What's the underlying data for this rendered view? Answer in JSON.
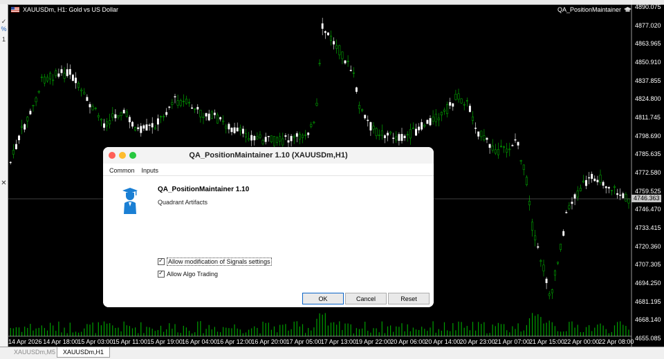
{
  "chart": {
    "symbol_title": "XAUUSDm, H1:  Gold vs US Dollar",
    "ea_badge": "QA_PositionMaintainer",
    "current_price": "4746.363",
    "price_ticks": [
      "4890.075",
      "4877.020",
      "4863.965",
      "4850.910",
      "4837.855",
      "4824.800",
      "4811.745",
      "4798.690",
      "4785.635",
      "4772.580",
      "4759.525",
      "4746.470",
      "4733.415",
      "4720.360",
      "4707.305",
      "4694.250",
      "4681.195",
      "4668.140",
      "4655.085"
    ],
    "time_ticks": [
      "14 Apr 2026",
      "14 Apr 18:00",
      "15 Apr 03:00",
      "15 Apr 11:00",
      "15 Apr 19:00",
      "16 Apr 04:00",
      "16 Apr 12:00",
      "16 Apr 20:00",
      "17 Apr 05:00",
      "17 Apr 13:00",
      "19 Apr 22:00",
      "20 Apr 06:00",
      "20 Apr 14:00",
      "20 Apr 23:00",
      "21 Apr 07:00",
      "21 Apr 15:00",
      "22 Apr 00:00",
      "22 Apr 08:00"
    ]
  },
  "tabs": [
    {
      "label": "XAUUSDm,M5",
      "active": false
    },
    {
      "label": "XAUUSDm,H1",
      "active": true
    }
  ],
  "left_panel": {
    "marks": [
      "✓",
      "%",
      "1"
    ]
  },
  "dialog": {
    "title": "QA_PositionMaintainer 1.10 (XAUUSDm,H1)",
    "tabs": [
      "Common",
      "Inputs"
    ],
    "ea_name": "QA_PositionMaintainer 1.10",
    "company": "Quadrant Artifacts",
    "checkboxes": [
      {
        "label": "Allow modification of Signals settings",
        "checked": true
      },
      {
        "label": "Allow Algo Trading",
        "checked": true
      }
    ],
    "buttons": {
      "ok": "OK",
      "cancel": "Cancel",
      "reset": "Reset"
    },
    "colors": {
      "close": "#ff5f57",
      "minimize": "#febc2e",
      "zoom": "#28c840",
      "icon": "#1a7fd4"
    }
  },
  "chart_colors": {
    "up": "#00c000",
    "down": "#ffffff",
    "background": "#000000",
    "volume": "#00a000",
    "bid_line": "#808080"
  }
}
